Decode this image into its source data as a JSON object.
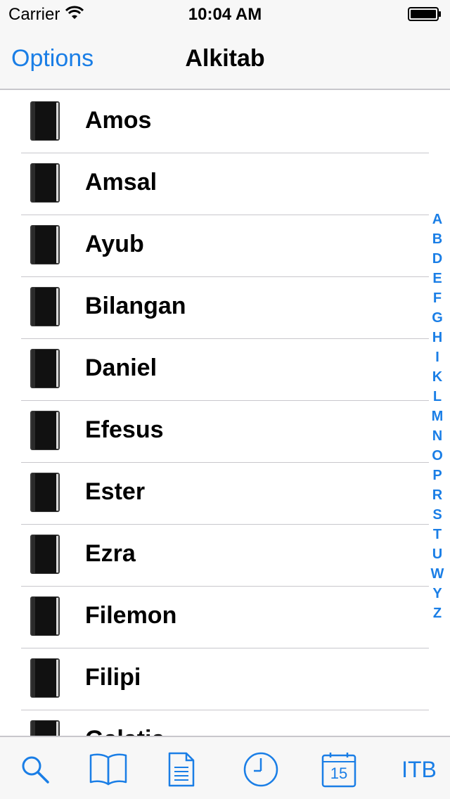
{
  "status_bar": {
    "carrier": "Carrier",
    "time": "10:04 AM"
  },
  "nav": {
    "left_button": "Options",
    "title": "Alkitab"
  },
  "books": [
    {
      "label": "Amos"
    },
    {
      "label": "Amsal"
    },
    {
      "label": "Ayub"
    },
    {
      "label": "Bilangan"
    },
    {
      "label": "Daniel"
    },
    {
      "label": "Efesus"
    },
    {
      "label": "Ester"
    },
    {
      "label": "Ezra"
    },
    {
      "label": "Filemon"
    },
    {
      "label": "Filipi"
    },
    {
      "label": "Galatia"
    }
  ],
  "section_index": [
    "A",
    "B",
    "D",
    "E",
    "F",
    "G",
    "H",
    "I",
    "K",
    "L",
    "M",
    "N",
    "O",
    "P",
    "R",
    "S",
    "T",
    "U",
    "W",
    "Y",
    "Z"
  ],
  "tab_bar": {
    "tabs": [
      {
        "icon": "search-icon"
      },
      {
        "icon": "open-book-icon"
      },
      {
        "icon": "document-icon"
      },
      {
        "icon": "clock-icon"
      },
      {
        "icon": "calendar-icon",
        "text": "15"
      },
      {
        "text": "ITB"
      }
    ]
  },
  "colors": {
    "accent": "#1a7ee6",
    "bar_background": "#f7f7f7",
    "separator": "#c8c7cc"
  }
}
